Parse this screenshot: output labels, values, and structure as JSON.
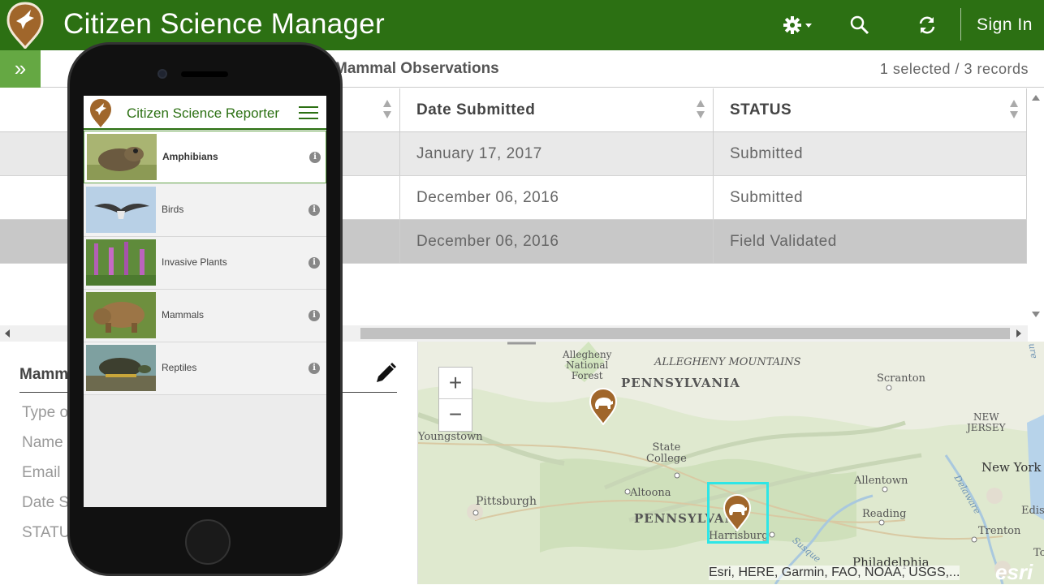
{
  "header": {
    "title": "Citizen Science Manager",
    "sign_in": "Sign In",
    "icons": [
      "gear-icon",
      "search-icon",
      "refresh-icon"
    ],
    "color": "#2c7013"
  },
  "subbar": {
    "expand_label": "»",
    "layer_title": "Mammal Observations",
    "records": "1 selected / 3 records"
  },
  "table": {
    "columns": [
      "",
      "Date Submitted",
      "STATUS"
    ],
    "rows": [
      {
        "date": "January 17, 2017",
        "status": "Submitted"
      },
      {
        "date": "December 06, 2016",
        "status": "Submitted"
      },
      {
        "date": "December 06, 2016",
        "status": "Field Validated"
      }
    ]
  },
  "details": {
    "title": "Mamm",
    "fields": [
      "Type o",
      "Name",
      "Email",
      "Date S",
      "STATU"
    ]
  },
  "map": {
    "zoom_in": "+",
    "zoom_out": "−",
    "labels": {
      "allegheny_forest": [
        "Allegheny",
        "National",
        "Forest"
      ],
      "mountains": "ALLEGHENY MOUNTAINS",
      "pennsylvania_top": "PENNSYLVANIA",
      "pennsylvania_mid": "PENNSYLVAN",
      "scranton": "Scranton",
      "new_jersey": [
        "NEW",
        "JERSEY"
      ],
      "new_york": "New York",
      "youngstown": "Youngstown",
      "state_college": [
        "State",
        "College"
      ],
      "pittsburgh": "Pittsburgh",
      "altoona": "Altoona",
      "allentown": "Allentown",
      "reading": "Reading",
      "edison": "Ediso",
      "trenton": "Trenton",
      "harrisburg": "Harrisburg",
      "philadelphia": "Philadelphia",
      "delaware": "Delaware",
      "susquehanna": "Susque",
      "edge_to": "To",
      "edge_ure": "ure"
    },
    "attribution": "Esri, HERE, Garmin, FAO, NOAA, USGS,...",
    "esri": "esri"
  },
  "phone_app": {
    "title": "Citizen Science Reporter",
    "categories": [
      {
        "label": "Amphibians",
        "selected": true
      },
      {
        "label": "Birds",
        "selected": false
      },
      {
        "label": "Invasive Plants",
        "selected": false
      },
      {
        "label": "Mammals",
        "selected": false
      },
      {
        "label": "Reptiles",
        "selected": false
      }
    ],
    "info_glyph": "i"
  }
}
